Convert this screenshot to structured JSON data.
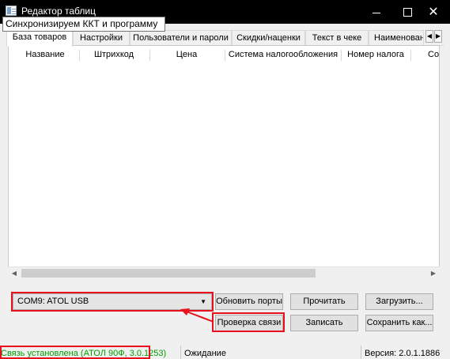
{
  "window": {
    "title": "Редактор таблиц",
    "close_glyph": "✕"
  },
  "tooltip": {
    "text": "Синхронизируем ККТ и программу"
  },
  "tabs": [
    {
      "label": "База товаров"
    },
    {
      "label": "Настройки"
    },
    {
      "label": "Пользователи и пароли"
    },
    {
      "label": "Скидки/наценки"
    },
    {
      "label": "Текст в чеке"
    },
    {
      "label": "Наименован"
    }
  ],
  "tab_nav": {
    "left": "◀",
    "right": "▶"
  },
  "table": {
    "columns": [
      "Название",
      "Штрихкод",
      "Цена",
      "Система налогообложения",
      "Номер налога",
      "Со"
    ],
    "rows": []
  },
  "port": {
    "selected": "COM9: ATOL USB",
    "chevron": "▼"
  },
  "buttons": {
    "refresh_ports": "Обновить порты",
    "read": "Прочитать",
    "load": "Загрузить...",
    "check_connection": "Проверка связи",
    "write": "Записать",
    "save_as": "Сохранить как..."
  },
  "status": {
    "connection": "Связь установлена (АТОЛ 90Ф, 3.0.1253)",
    "state": "Ожидание",
    "version": "Версия: 2.0.1.1886"
  },
  "colors": {
    "accent_red": "#e8101d",
    "status_green": "#00a000",
    "title_bar": "#000000"
  },
  "icons": {
    "app": "table-editor-icon",
    "arrow": "red-arrow-icon"
  }
}
